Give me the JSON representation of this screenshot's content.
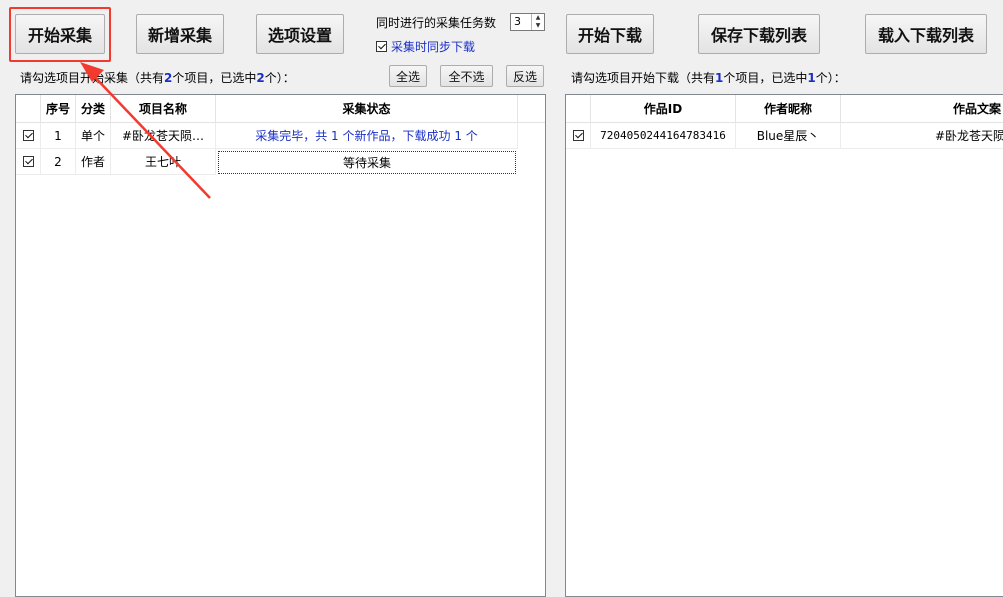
{
  "toolbar": {
    "start_collect": "开始采集",
    "add_collect": "新增采集",
    "options": "选项设置",
    "concurrent_label": "同时进行的采集任务数",
    "concurrent_value": "3",
    "sync_download_label": "采集时同步下载",
    "start_download": "开始下载",
    "save_list": "保存下载列表",
    "load_list": "载入下载列表"
  },
  "left": {
    "info_prefix": "请勾选项目开始采集（共有",
    "info_total": "2",
    "info_mid": "个项目，已选中",
    "info_selected": "2",
    "info_suffix": "个）：",
    "select_all": "全选",
    "select_none": "全不选",
    "invert": "反选",
    "headers": {
      "index": "序号",
      "category": "分类",
      "name": "项目名称",
      "status": "采集状态"
    },
    "rows": [
      {
        "index": "1",
        "category": "单个",
        "name": "#卧龙苍天陨…",
        "status": "采集完毕，共 1 个新作品，下载成功 1 个"
      },
      {
        "index": "2",
        "category": "作者",
        "name": "王七叶",
        "status": "等待采集"
      }
    ]
  },
  "right": {
    "info_prefix": "请勾选项目开始下载（共有",
    "info_total": "1",
    "info_mid": "个项目，已选中",
    "info_selected": "1",
    "info_suffix": "个）：",
    "headers": {
      "id": "作品ID",
      "author": "作者昵称",
      "caption": "作品文案"
    },
    "rows": [
      {
        "id": "7204050244164783416",
        "author": "Blue星辰丶",
        "caption": "#卧龙苍天陨"
      }
    ]
  },
  "colors": {
    "highlight": "#f23a2e",
    "accent_text": "#1a2fc9"
  }
}
